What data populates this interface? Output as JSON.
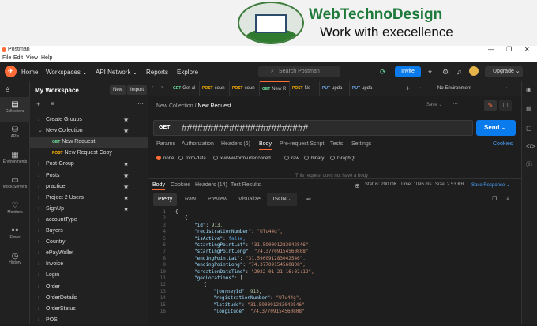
{
  "banner": {
    "brand": "WebTechnoDesign",
    "tagline": "Work with execellence"
  },
  "window": {
    "title": "Postman",
    "controls": [
      "—",
      "❐",
      "✕"
    ]
  },
  "menu": [
    "File",
    "Edit",
    "View",
    "Help"
  ],
  "header": {
    "nav": [
      "Home",
      "Workspaces ⌄",
      "API Network ⌄",
      "Reports",
      "Explore"
    ],
    "search_placeholder": "Search Postman",
    "invite": "Invite",
    "upgrade": "Upgrade ⌄"
  },
  "rail": [
    "Collections",
    "APIs",
    "Environments",
    "Mock Servers",
    "Monitors",
    "Flows",
    "History"
  ],
  "sidebar": {
    "workspace": "My Workspace",
    "new": "New",
    "import": "Import",
    "items": [
      {
        "label": "Create Groups",
        "star": true,
        "chev": "›"
      },
      {
        "label": "New Collection",
        "star": true,
        "chev": "⌄"
      },
      {
        "label": "New Request",
        "method": "GET",
        "child": true,
        "selected": true
      },
      {
        "label": "New Request Copy",
        "method": "POST",
        "child": true
      },
      {
        "label": "Post-Group",
        "star": true,
        "chev": "›"
      },
      {
        "label": "Posts",
        "star": true,
        "chev": "›"
      },
      {
        "label": "practice",
        "star": true,
        "chev": "›"
      },
      {
        "label": "Project 2 Users",
        "star": true,
        "chev": "›"
      },
      {
        "label": "SignUp",
        "star": true,
        "chev": "›"
      },
      {
        "label": "accountType",
        "chev": "›"
      },
      {
        "label": "Buyers",
        "chev": "›"
      },
      {
        "label": "Country",
        "chev": "›"
      },
      {
        "label": "ePayWallet",
        "chev": "›"
      },
      {
        "label": "Invoice",
        "chev": "›"
      },
      {
        "label": "Login",
        "chev": "›"
      },
      {
        "label": "Order",
        "chev": "›"
      },
      {
        "label": "OrderDetails",
        "chev": "›"
      },
      {
        "label": "OrderStatus",
        "chev": "›"
      },
      {
        "label": "POS",
        "chev": "›"
      }
    ]
  },
  "tabs": [
    {
      "method": "GET",
      "label": "Get al"
    },
    {
      "method": "POST",
      "label": "coun"
    },
    {
      "method": "POST",
      "label": "coun"
    },
    {
      "method": "GET",
      "label": "New R",
      "active": true
    },
    {
      "method": "POST",
      "label": "No"
    },
    {
      "method": "PUT",
      "label": "upda"
    },
    {
      "method": "PUT",
      "label": "upda"
    }
  ],
  "environment": "No Environment",
  "request": {
    "breadcrumb_parent": "New Collection /",
    "breadcrumb_current": "New Request",
    "save": "Save ⌄",
    "method": "GET",
    "url": "########################",
    "send": "Send ⌄",
    "tabs": [
      "Params",
      "Authorization",
      "Headers (6)",
      "Body",
      "Pre-request Script",
      "Tests",
      "Settings"
    ],
    "cookies": "Cookies",
    "body_types": [
      "none",
      "form-data",
      "x-www-form-urlencoded",
      "raw",
      "binary",
      "GraphQL"
    ],
    "no_body": "This request does not have a body"
  },
  "response": {
    "tabs": [
      "Body",
      "Cookies",
      "Headers (14)",
      "Test Results"
    ],
    "status": "Status: 200 OK",
    "time": "Time: 1096 ms",
    "size": "Size: 2.53 KB",
    "save": "Save Response ⌄",
    "views": [
      "Pretty",
      "Raw",
      "Preview",
      "Visualize"
    ],
    "format": "JSON ⌄",
    "lines": [
      {
        "n": "1",
        "t": "{",
        "i": 0
      },
      {
        "n": "2",
        "t": "{",
        "i": 1
      },
      {
        "n": "3",
        "k": "\"id\"",
        "v": "913,",
        "vt": "num",
        "i": 2
      },
      {
        "n": "4",
        "k": "\"registrationNumber\"",
        "v": "\"Ulu44g\",",
        "vt": "str",
        "i": 2
      },
      {
        "n": "5",
        "k": "\"isActive\"",
        "v": "false,",
        "vt": "bool",
        "i": 2
      },
      {
        "n": "6",
        "k": "\"startingPointLat\"",
        "v": "\"31.590091283042546\",",
        "vt": "str",
        "i": 2
      },
      {
        "n": "7",
        "k": "\"startingPointLong\"",
        "v": "\"74.37709154560808\",",
        "vt": "str",
        "i": 2
      },
      {
        "n": "8",
        "k": "\"endingPointLat\"",
        "v": "\"31.590091283042546\",",
        "vt": "str",
        "i": 2
      },
      {
        "n": "9",
        "k": "\"endingPointLong\"",
        "v": "\"74.37709154560808\",",
        "vt": "str",
        "i": 2
      },
      {
        "n": "10",
        "k": "\"creationDateTime\"",
        "v": "\"2022-01-21 16:02:12\",",
        "vt": "str",
        "i": 2
      },
      {
        "n": "11",
        "k": "\"geoLocations\"",
        "v": "[",
        "vt": "plain",
        "i": 2
      },
      {
        "n": "12",
        "t": "{",
        "i": 3
      },
      {
        "n": "13",
        "k": "\"journeyId\"",
        "v": "913,",
        "vt": "num",
        "i": 4
      },
      {
        "n": "14",
        "k": "\"registrationNumber\"",
        "v": "\"Ulu44g\",",
        "vt": "str",
        "i": 4
      },
      {
        "n": "15",
        "k": "\"latitude\"",
        "v": "\"31.590091283042546\",",
        "vt": "str",
        "i": 4
      },
      {
        "n": "16",
        "k": "\"longitude\"",
        "v": "\"74.37709154560808\",",
        "vt": "str",
        "i": 4
      }
    ]
  }
}
